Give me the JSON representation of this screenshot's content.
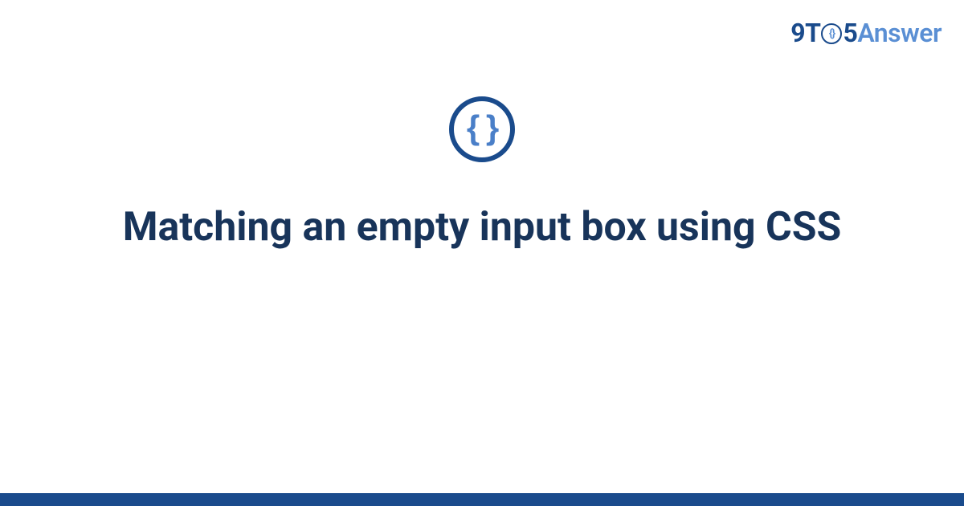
{
  "logo": {
    "part1": "9T",
    "clock_inner": "{}",
    "part2": "5",
    "part3": "Answer"
  },
  "icon": {
    "glyph": "{ }",
    "name": "css-braces-icon"
  },
  "title": "Matching an empty input box using CSS",
  "colors": {
    "primary_dark": "#1a4b8c",
    "primary_light": "#5a8fd4",
    "title_color": "#18345a"
  }
}
